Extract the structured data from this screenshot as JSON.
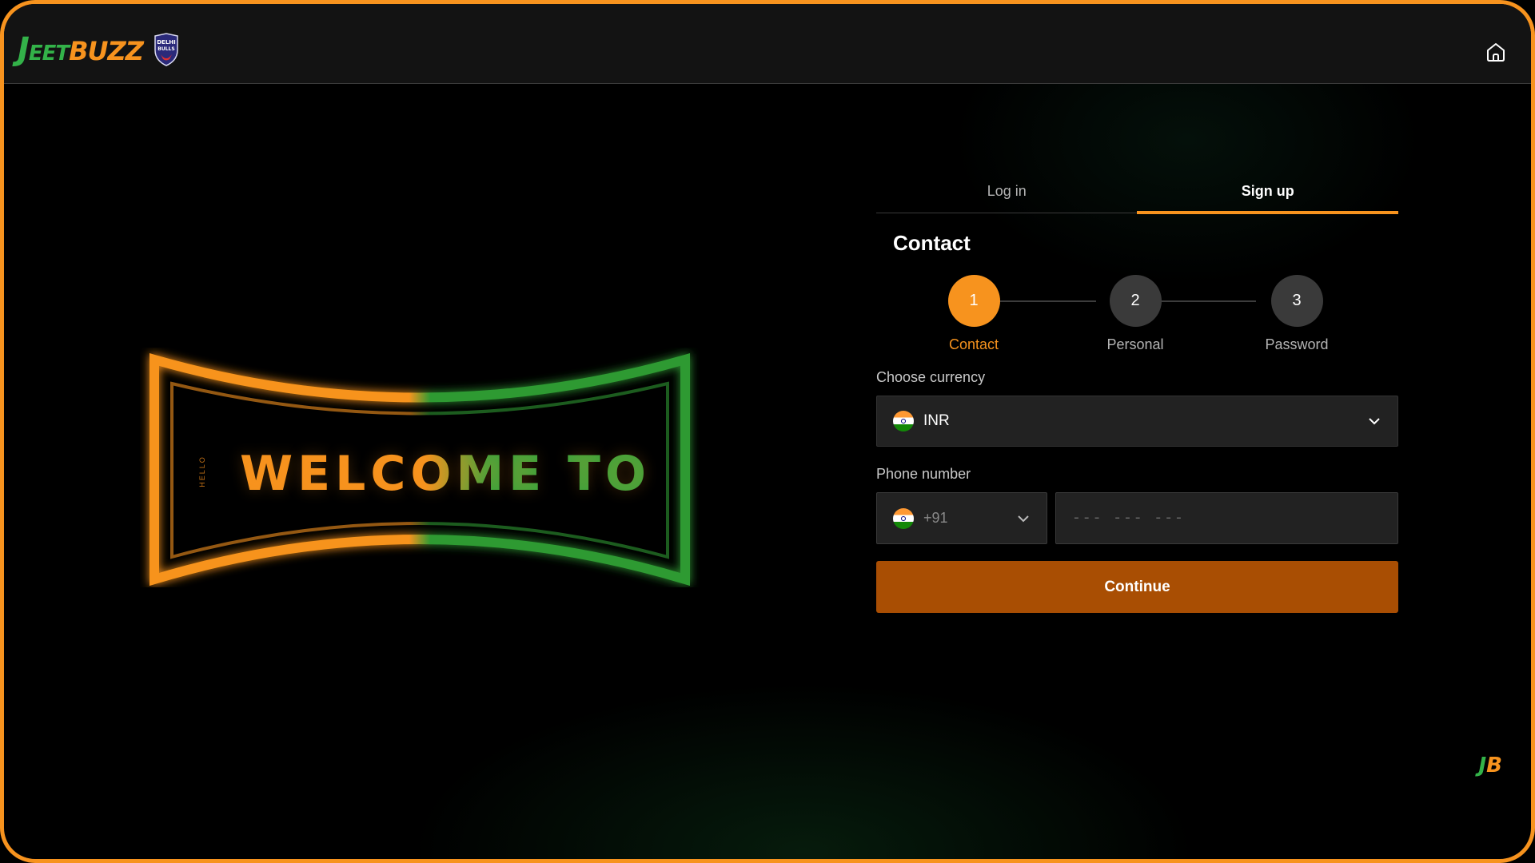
{
  "header": {
    "logo_j": "J",
    "logo_jeet": "EET",
    "logo_buzz": "BUZZ",
    "partner_badge": "DELHI BULLS",
    "home_icon": "home-icon"
  },
  "hero": {
    "welcome_text": "WELCOME TO",
    "side_text": "HELLO"
  },
  "auth": {
    "tabs": [
      {
        "label": "Log in",
        "active": false
      },
      {
        "label": "Sign up",
        "active": true
      }
    ],
    "section_title": "Contact",
    "steps": [
      {
        "number": "1",
        "label": "Contact",
        "active": true
      },
      {
        "number": "2",
        "label": "Personal",
        "active": false
      },
      {
        "number": "3",
        "label": "Password",
        "active": false
      }
    ],
    "currency_label": "Choose currency",
    "currency_value": "INR",
    "phone_label": "Phone number",
    "phone_code": "+91",
    "phone_placeholder": "--- --- ---",
    "continue_label": "Continue"
  },
  "corner_badge": {
    "j": "J",
    "b": "B"
  },
  "colors": {
    "accent": "#f7931e",
    "accent_dark": "#a94e03",
    "brand_green": "#33b249",
    "panel": "#222222",
    "background": "#000000"
  }
}
